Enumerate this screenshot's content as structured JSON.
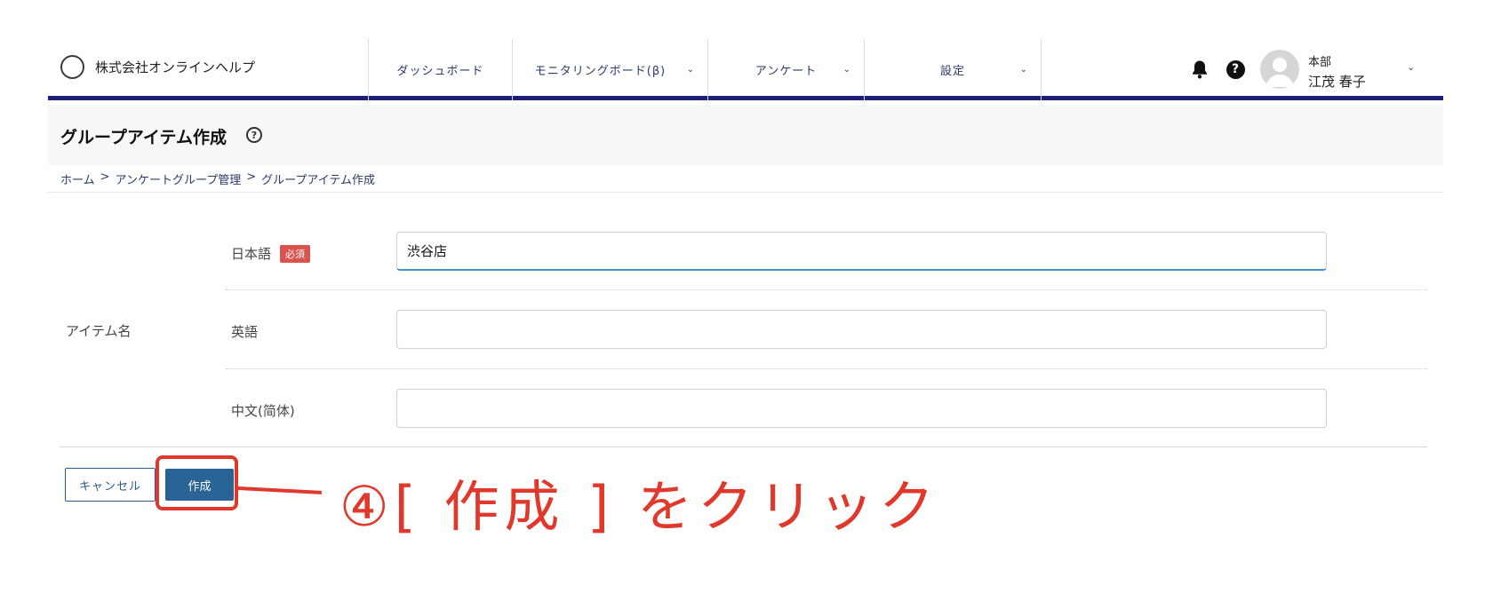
{
  "header": {
    "company_name": "株式会社オンラインヘルプ",
    "nav": [
      {
        "label": "ダッシュボード",
        "has_dropdown": false
      },
      {
        "label": "モニタリングボード(β)",
        "has_dropdown": true
      },
      {
        "label": "アンケート",
        "has_dropdown": true
      },
      {
        "label": "設定",
        "has_dropdown": true
      }
    ],
    "icons": {
      "notification": "bell-icon",
      "help": "question-icon"
    },
    "help_glyph": "?",
    "chevron_glyph": "⌄",
    "user": {
      "department": "本部",
      "name": "江茂 春子"
    }
  },
  "page": {
    "title": "グループアイテム作成",
    "help_glyph": "?",
    "breadcrumb": [
      "ホーム",
      "アンケートグループ管理",
      "グループアイテム作成"
    ],
    "breadcrumb_separator": ">"
  },
  "form": {
    "section_label": "アイテム名",
    "required_badge": "必須",
    "fields": [
      {
        "label": "日本語",
        "value": "渋谷店",
        "required": true
      },
      {
        "label": "英語",
        "value": "",
        "required": false
      },
      {
        "label": "中文(简体)",
        "value": "",
        "required": false
      }
    ]
  },
  "actions": {
    "cancel_label": "キャンセル",
    "create_label": "作成"
  },
  "annotation": {
    "text": "④[ 作成 ] をクリック",
    "color": "#e0392b"
  },
  "colors": {
    "brand_navy": "#1b1e7a",
    "primary_button": "#2a6496",
    "required_badge": "#d9534f"
  }
}
